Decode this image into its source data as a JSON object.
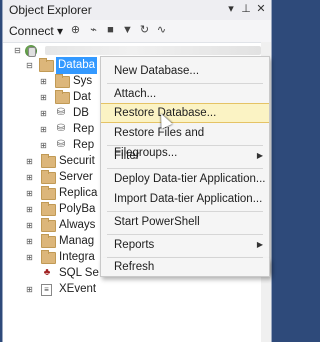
{
  "window": {
    "title": "Object Explorer",
    "pin_icon": "pin-icon",
    "close_icon": "close-icon",
    "dropdown_icon": "chevron-down-icon"
  },
  "toolbar": {
    "connect_label": "Connect ▾",
    "tools": [
      "connect-object-explorer-icon",
      "disconnect-icon",
      "stop-icon",
      "filter-icon",
      "refresh-icon",
      "activity-monitor-icon"
    ]
  },
  "tree": {
    "server": {
      "label": "",
      "expanded": "⊟"
    },
    "databases": {
      "label": "Databa",
      "expanded": "⊟"
    },
    "children": [
      {
        "label": "Sys",
        "expander": "⊞",
        "icon": "folder"
      },
      {
        "label": "Dat",
        "expander": "⊞",
        "icon": "folder"
      },
      {
        "label": "DB",
        "expander": "⊞",
        "icon": "database"
      },
      {
        "label": "Rep",
        "expander": "⊞",
        "icon": "database"
      },
      {
        "label": "Rep",
        "expander": "⊞",
        "icon": "database"
      }
    ],
    "top_level": [
      {
        "label": "Securit",
        "expander": "⊞"
      },
      {
        "label": "Server",
        "expander": "⊞"
      },
      {
        "label": "Replica",
        "expander": "⊞"
      },
      {
        "label": "PolyBa",
        "expander": "⊞"
      },
      {
        "label": "Always",
        "expander": "⊞"
      },
      {
        "label": "Manag",
        "expander": "⊞"
      },
      {
        "label": "Integra",
        "expander": "⊞"
      },
      {
        "label": "SQL Se",
        "expander": ""
      },
      {
        "label": "XEvent",
        "expander": "⊞"
      }
    ]
  },
  "context_menu": {
    "items": [
      {
        "label": "New Database...",
        "submenu": false,
        "highlighted": false
      },
      {
        "label": "Attach...",
        "submenu": false,
        "highlighted": false
      },
      {
        "label": "Restore Database...",
        "submenu": false,
        "highlighted": true
      },
      {
        "label": "Restore Files and Filegroups...",
        "submenu": false,
        "highlighted": false
      },
      {
        "label": "Filter",
        "submenu": true,
        "highlighted": false
      },
      {
        "label": "Deploy Data-tier Application...",
        "submenu": false,
        "highlighted": false
      },
      {
        "label": "Import Data-tier Application...",
        "submenu": false,
        "highlighted": false
      },
      {
        "label": "Start PowerShell",
        "submenu": false,
        "highlighted": false
      },
      {
        "label": "Reports",
        "submenu": true,
        "highlighted": false
      },
      {
        "label": "Refresh",
        "submenu": false,
        "highlighted": false
      }
    ],
    "submenu_arrow": "▶"
  }
}
